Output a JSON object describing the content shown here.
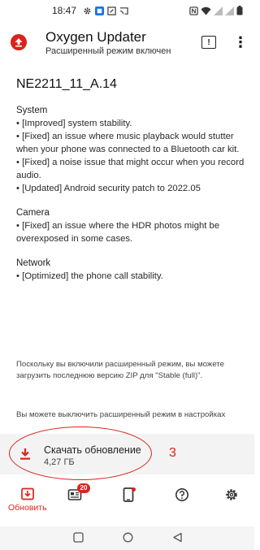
{
  "status_bar": {
    "time": "18:47"
  },
  "app_bar": {
    "title": "Oxygen Updater",
    "subtitle": "Расширенный режим включен",
    "changelog_glyph": "!",
    "overflow_glyph": "⋮"
  },
  "update": {
    "version": "NE2211_11_A.14",
    "sections": [
      {
        "title": "System",
        "items": [
          "• [Improved] system stability.",
          "• [Fixed] an issue where music playback would stutter when your phone was connected to a Bluetooth car kit.",
          "• [Fixed] a noise issue that might occur when you record audio.",
          "• [Updated] Android security patch to 2022.05"
        ]
      },
      {
        "title": "Camera",
        "items": [
          "• [Fixed] an issue where the HDR photos might be overexposed in some cases."
        ]
      },
      {
        "title": "Network",
        "items": [
          "• [Optimized] the phone call stability."
        ]
      }
    ],
    "notice": "Поскольку вы включили расширенный режим, вы можете загрузить последнюю версию ZIP для \"Stable (full)\".",
    "notice2": "Вы можете выключить расширенный режим в настройках"
  },
  "download": {
    "title": "Скачать обновление",
    "size": "4,27 ГБ"
  },
  "annotation": {
    "number": "3"
  },
  "bottom_nav": {
    "update_label": "Обновить",
    "news_badge": "20"
  },
  "colors": {
    "accent": "#d9241b"
  }
}
